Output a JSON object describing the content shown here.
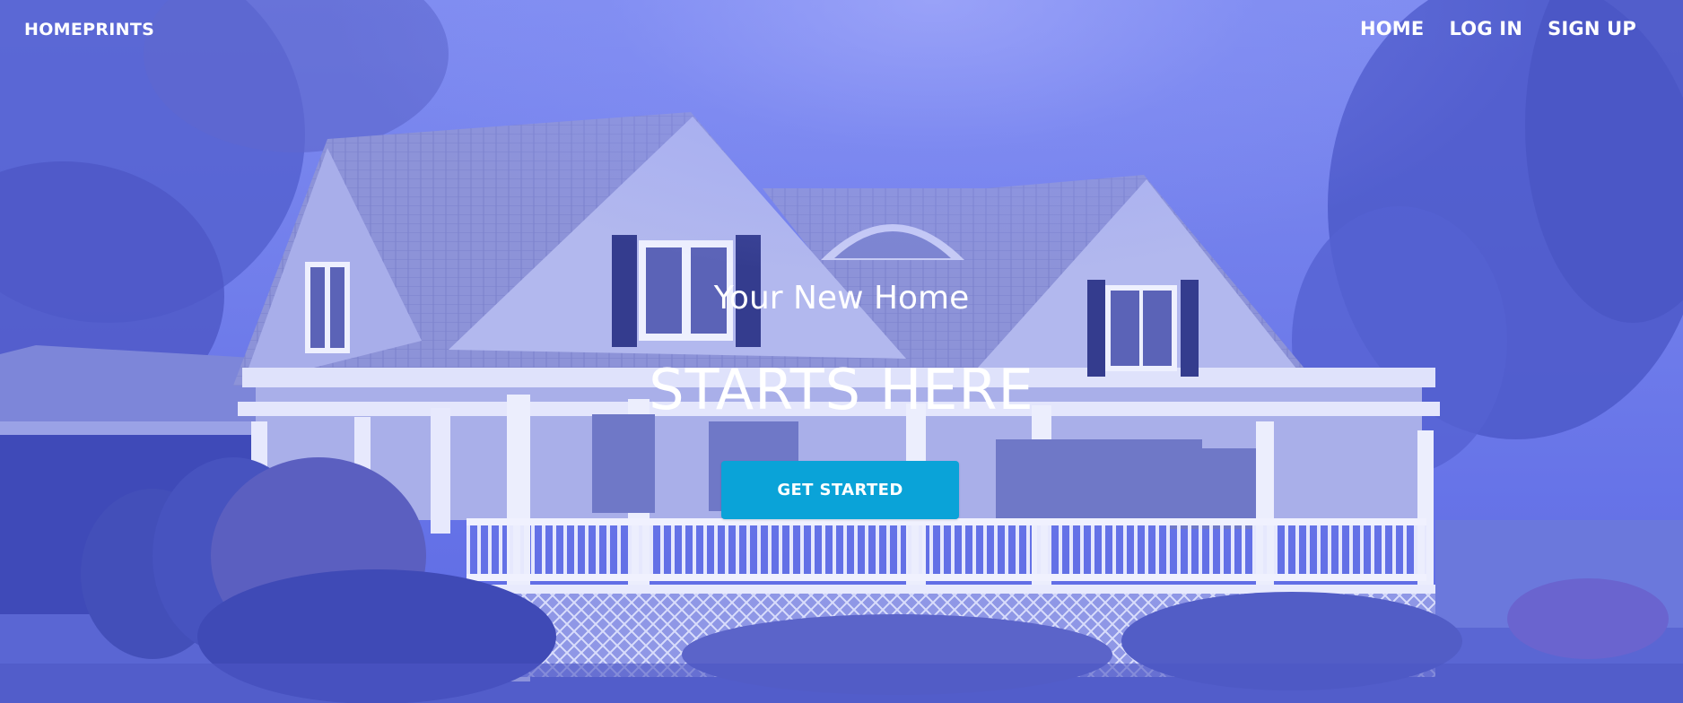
{
  "navbar": {
    "brand": "HOMEPRINTS",
    "links": [
      {
        "label": "HOME"
      },
      {
        "label": "LOG IN"
      },
      {
        "label": "SIGN UP"
      }
    ]
  },
  "hero": {
    "subtitle": "Your New Home",
    "title": "STARTS HERE",
    "cta_label": "GET STARTED",
    "background_image": "house-photo-with-blue-overlay"
  },
  "colors": {
    "overlay": "#5a67e0",
    "cta_background": "#0aa3d8",
    "text": "#ffffff"
  }
}
